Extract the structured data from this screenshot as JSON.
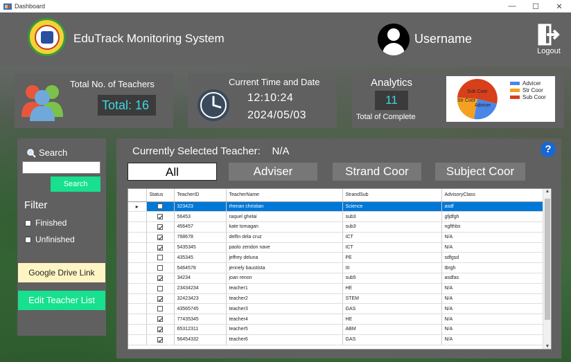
{
  "window": {
    "title": "Dashboard",
    "controls": [
      "—",
      "☐",
      "✕"
    ]
  },
  "header": {
    "app_title": "EduTrack Monitoring System",
    "username": "Username",
    "logout_label": "Logout"
  },
  "teachers_card": {
    "title": "Total No. of Teachers",
    "total": "Total: 16"
  },
  "time_card": {
    "title": "Current Time and Date",
    "time": "12:10:24",
    "date": "2024/05/03"
  },
  "analytics_card": {
    "title": "Analytics",
    "count": "11",
    "subtitle": "Total of Complete",
    "pie_labels": {
      "sub": "Sub Coor",
      "str": "Str Coor",
      "adv": "Advicer"
    },
    "legend": [
      {
        "label": "Advicer",
        "color": "#4a86e8"
      },
      {
        "label": "Str Coor",
        "color": "#f4a020"
      },
      {
        "label": "Sub Coor",
        "color": "#d7401a"
      }
    ]
  },
  "sidebar": {
    "search_label": "Search",
    "search_value": "",
    "search_button": "Search",
    "filter_label": "Filter",
    "finished_label": "Finished",
    "unfinished_label": "Unfinished",
    "gdrive_button": "Google Drive Link",
    "edit_button": "Edit Teacher List"
  },
  "main": {
    "selected_label": "Currently Selected Teacher:",
    "selected_value": "N/A",
    "help": "?",
    "tabs": [
      "All",
      "Adviser",
      "Strand Coor",
      "Subject Coor"
    ]
  },
  "grid": {
    "columns": [
      "Status",
      "TeacherID",
      "TeacherName",
      "StrandSub",
      "AdvisoryClass"
    ],
    "rows": [
      {
        "status": false,
        "id": "323423",
        "name": "rhenan christian",
        "strand": "Science",
        "advisory": "asdf",
        "selected": true
      },
      {
        "status": true,
        "id": "56453",
        "name": "raquel ghelai",
        "strand": "sub3",
        "advisory": "gfjdfgh"
      },
      {
        "status": true,
        "id": "456457",
        "name": "kate tomagan",
        "strand": "sub3",
        "advisory": "ngfthbs"
      },
      {
        "status": true,
        "id": "768678",
        "name": "delfin dela cruz",
        "strand": "ICT",
        "advisory": "N/A"
      },
      {
        "status": true,
        "id": "5435345",
        "name": "paolo zendon nave",
        "strand": "ICT",
        "advisory": "N/A"
      },
      {
        "status": false,
        "id": "435345",
        "name": "jeffrey deluna",
        "strand": "PE",
        "advisory": "sdfgsd"
      },
      {
        "status": false,
        "id": "5464578",
        "name": "jennely baustista",
        "strand": "III",
        "advisory": "tbrgh"
      },
      {
        "status": true,
        "id": "34234",
        "name": "joan renon",
        "strand": "sub5",
        "advisory": "asdfas"
      },
      {
        "status": false,
        "id": "23434234",
        "name": "teacher1",
        "strand": "HE",
        "advisory": "N/A"
      },
      {
        "status": true,
        "id": "32423423",
        "name": "teacher2",
        "strand": "STEM",
        "advisory": "N/A"
      },
      {
        "status": false,
        "id": "43565745",
        "name": "teacher3",
        "strand": "GAS",
        "advisory": "N/A"
      },
      {
        "status": true,
        "id": "77435345",
        "name": "teacher4",
        "strand": "HE",
        "advisory": "N/A"
      },
      {
        "status": true,
        "id": "65312311",
        "name": "teacher5",
        "strand": "ABM",
        "advisory": "N/A"
      },
      {
        "status": true,
        "id": "56454332",
        "name": "teacher6",
        "strand": "GAS",
        "advisory": "N/A"
      }
    ]
  },
  "colors": {
    "accent_green": "#17e08f",
    "value_cyan": "#3fd7e5",
    "panel": "#606060",
    "selection": "#0078d7"
  }
}
